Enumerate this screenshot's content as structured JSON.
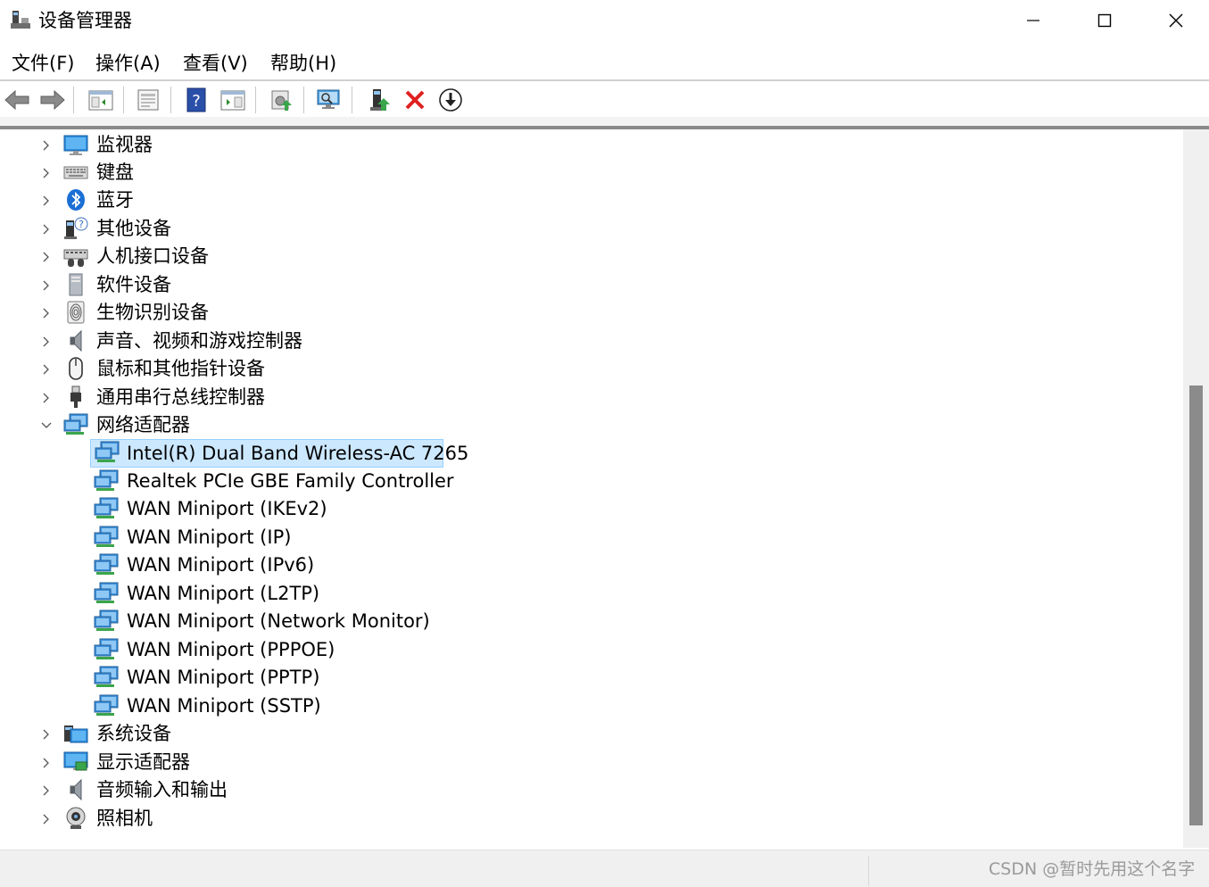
{
  "window": {
    "title": "设备管理器",
    "controls": {
      "minimize": "minimize-icon",
      "maximize": "maximize-icon",
      "close": "close-icon"
    }
  },
  "menu": [
    {
      "label": "文件(F)"
    },
    {
      "label": "操作(A)"
    },
    {
      "label": "查看(V)"
    },
    {
      "label": "帮助(H)"
    }
  ],
  "toolbar": [
    {
      "icon": "back-arrow-icon"
    },
    {
      "icon": "forward-arrow-icon"
    },
    {
      "icon": "show-hide-console-tree-icon"
    },
    {
      "icon": "properties-icon"
    },
    {
      "icon": "help-icon"
    },
    {
      "icon": "action-pane-icon"
    },
    {
      "icon": "update-driver-icon"
    },
    {
      "icon": "scan-hardware-icon"
    },
    {
      "icon": "enable-device-icon"
    },
    {
      "icon": "uninstall-device-icon"
    },
    {
      "icon": "download-driver-icon"
    }
  ],
  "tree": {
    "categories_before": [
      {
        "label": "监视器",
        "icon": "monitor-icon"
      },
      {
        "label": "键盘",
        "icon": "keyboard-icon"
      },
      {
        "label": "蓝牙",
        "icon": "bluetooth-icon"
      },
      {
        "label": "其他设备",
        "icon": "unknown-device-icon"
      },
      {
        "label": "人机接口设备",
        "icon": "hid-icon"
      },
      {
        "label": "软件设备",
        "icon": "software-device-icon"
      },
      {
        "label": "生物识别设备",
        "icon": "fingerprint-icon"
      },
      {
        "label": "声音、视频和游戏控制器",
        "icon": "speaker-icon"
      },
      {
        "label": "鼠标和其他指针设备",
        "icon": "mouse-icon"
      },
      {
        "label": "通用串行总线控制器",
        "icon": "usb-icon"
      }
    ],
    "expanded_category": {
      "label": "网络适配器",
      "icon": "network-adapter-icon"
    },
    "adapters": [
      {
        "label": "Intel(R) Dual Band Wireless-AC 7265",
        "selected": true
      },
      {
        "label": "Realtek PCIe GBE Family Controller"
      },
      {
        "label": "WAN Miniport (IKEv2)"
      },
      {
        "label": "WAN Miniport (IP)"
      },
      {
        "label": "WAN Miniport (IPv6)"
      },
      {
        "label": "WAN Miniport (L2TP)"
      },
      {
        "label": "WAN Miniport (Network Monitor)"
      },
      {
        "label": "WAN Miniport (PPPOE)"
      },
      {
        "label": "WAN Miniport (PPTP)"
      },
      {
        "label": "WAN Miniport (SSTP)"
      }
    ],
    "categories_after": [
      {
        "label": "系统设备",
        "icon": "system-folder-icon"
      },
      {
        "label": "显示适配器",
        "icon": "display-adapter-icon"
      },
      {
        "label": "音频输入和输出",
        "icon": "speaker-icon"
      },
      {
        "label": "照相机",
        "icon": "camera-icon"
      }
    ]
  },
  "status": {
    "watermark": "CSDN @暂时先用这个名字"
  },
  "colors": {
    "selection": "#cce8ff",
    "selection_border": "#99d1ff",
    "net_blue": "#3c8fd8",
    "net_green": "#3aa54a"
  }
}
